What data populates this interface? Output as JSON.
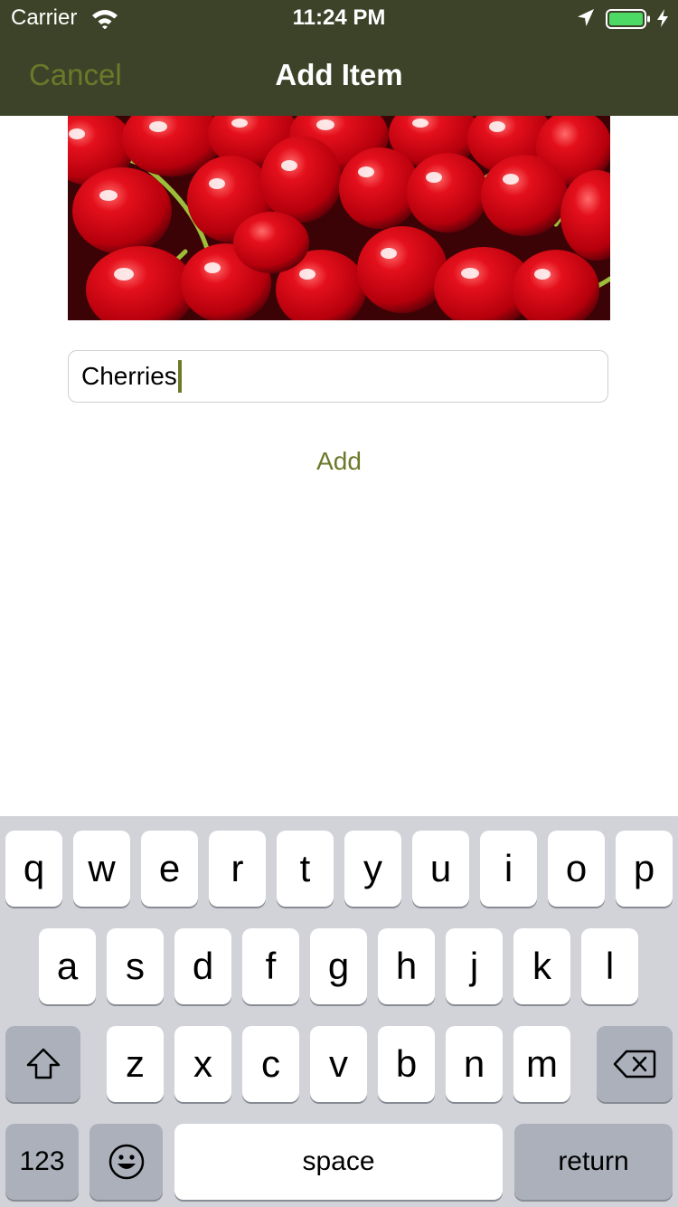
{
  "status_bar": {
    "carrier": "Carrier",
    "time": "11:24 PM",
    "icons": [
      "wifi-icon",
      "location-arrow-icon",
      "battery-icon",
      "charging-bolt-icon"
    ],
    "battery_color": "#4cd964"
  },
  "nav": {
    "cancel_label": "Cancel",
    "title": "Add Item",
    "background_color": "#3d4329",
    "accent_color": "#6b7a2a"
  },
  "photo": {
    "subject": "cherries"
  },
  "name_field": {
    "value": "Cherries"
  },
  "add_label": "Add",
  "keyboard": {
    "row1": [
      "q",
      "w",
      "e",
      "r",
      "t",
      "y",
      "u",
      "i",
      "o",
      "p"
    ],
    "row2": [
      "a",
      "s",
      "d",
      "f",
      "g",
      "h",
      "j",
      "k",
      "l"
    ],
    "row3": [
      "z",
      "x",
      "c",
      "v",
      "b",
      "n",
      "m"
    ],
    "numbers_label": "123",
    "space_label": "space",
    "return_label": "return",
    "special_icons": [
      "shift-icon",
      "backspace-icon",
      "emoji-icon"
    ]
  }
}
